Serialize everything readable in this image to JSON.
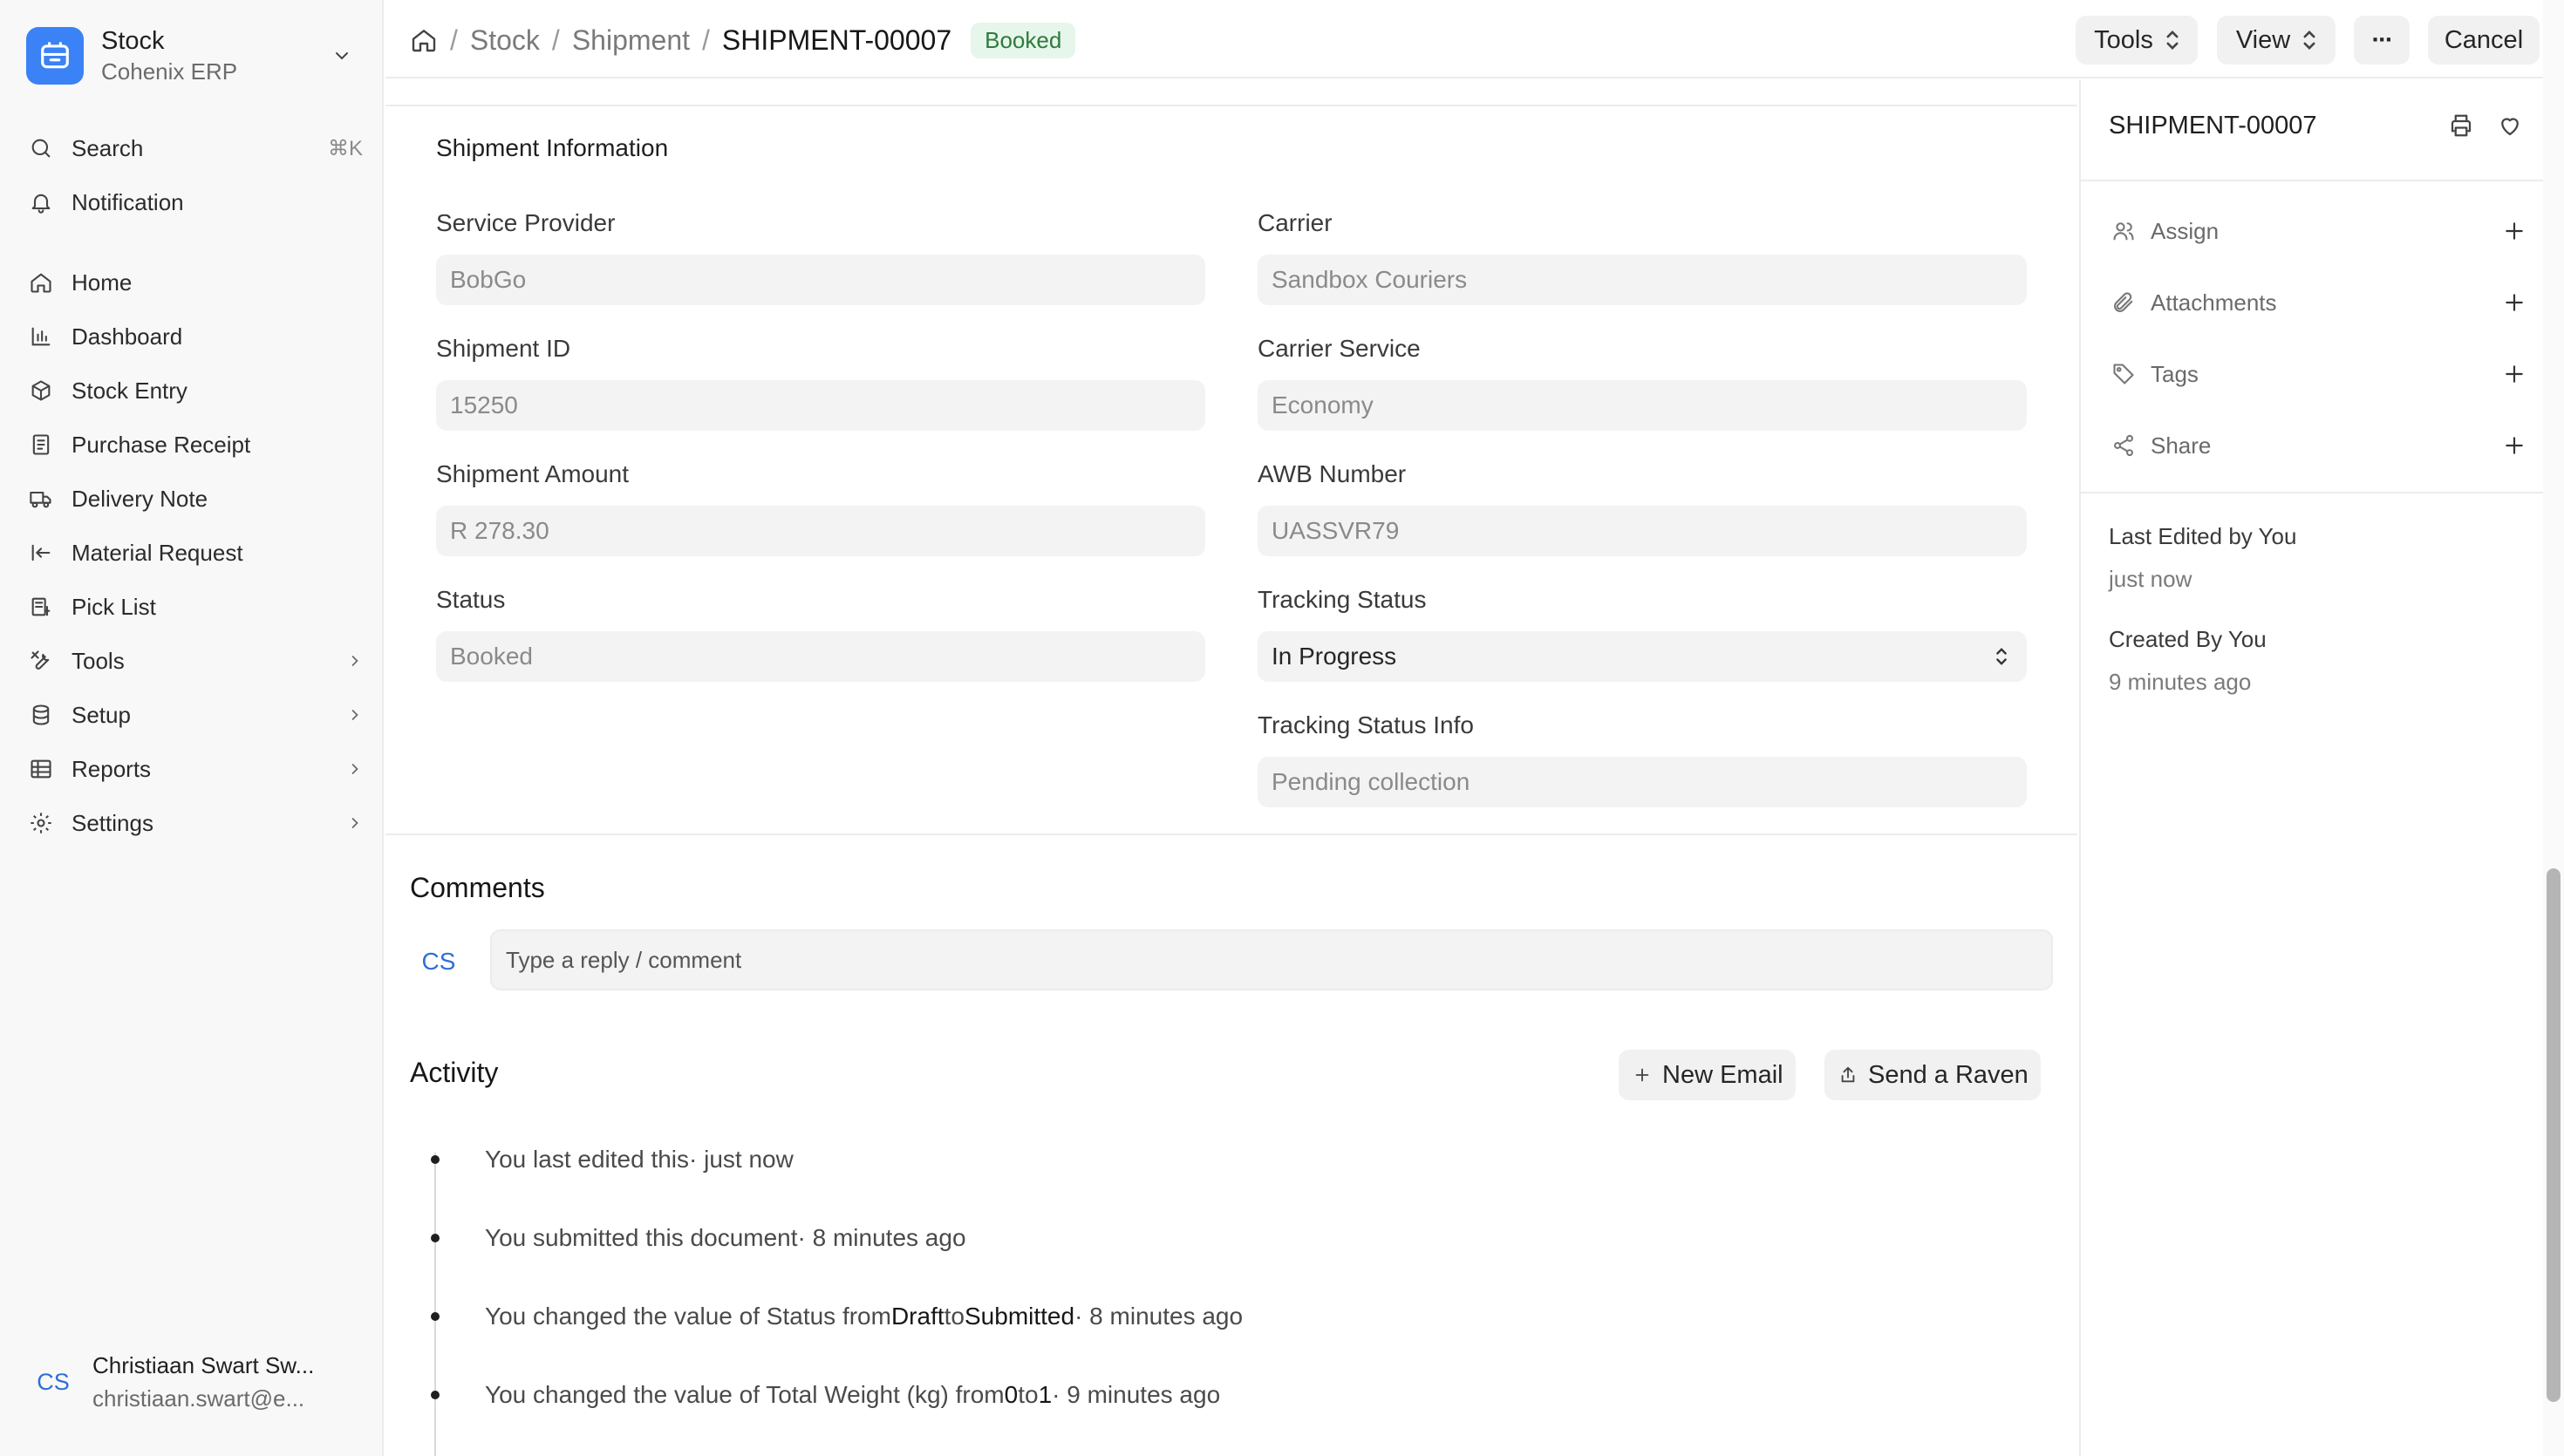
{
  "workspace": {
    "name": "Stock",
    "org": "Cohenix ERP",
    "accent": "#3b82f6"
  },
  "sidebar": {
    "search_label": "Search",
    "search_shortcut": "⌘K",
    "notification_label": "Notification",
    "items": [
      {
        "label": "Home",
        "icon": "home-icon"
      },
      {
        "label": "Dashboard",
        "icon": "bar-chart-icon"
      },
      {
        "label": "Stock Entry",
        "icon": "package-icon"
      },
      {
        "label": "Purchase Receipt",
        "icon": "receipt-icon"
      },
      {
        "label": "Delivery Note",
        "icon": "truck-icon"
      },
      {
        "label": "Material Request",
        "icon": "arrow-left-to-line-icon"
      },
      {
        "label": "Pick List",
        "icon": "pick-list-icon"
      },
      {
        "label": "Tools",
        "icon": "tools-icon"
      },
      {
        "label": "Setup",
        "icon": "database-icon"
      },
      {
        "label": "Reports",
        "icon": "table-icon"
      },
      {
        "label": "Settings",
        "icon": "gear-icon"
      }
    ],
    "user": {
      "initials": "CS",
      "name": "Christiaan Swart Sw...",
      "email": "christiaan.swart@e..."
    }
  },
  "header": {
    "breadcrumbs": [
      "Stock",
      "Shipment",
      "SHIPMENT-00007"
    ],
    "status_badge": "Booked",
    "tools_label": "Tools",
    "view_label": "View",
    "more_label": "···",
    "cancel_label": "Cancel"
  },
  "form": {
    "section_title": "Shipment Information",
    "left": [
      {
        "label": "Service Provider",
        "value": "BobGo"
      },
      {
        "label": "Shipment ID",
        "value": "15250"
      },
      {
        "label": "Shipment Amount",
        "value": "R 278.30"
      },
      {
        "label": "Status",
        "value": "Booked"
      }
    ],
    "right": [
      {
        "label": "Carrier",
        "value": "Sandbox Couriers"
      },
      {
        "label": "Carrier Service",
        "value": "Economy"
      },
      {
        "label": "AWB Number",
        "value": "UASSVR79"
      },
      {
        "label": "Tracking Status",
        "value": "In Progress"
      },
      {
        "label": "Tracking Status Info",
        "value": "Pending collection"
      }
    ]
  },
  "comments": {
    "title": "Comments",
    "avatar": "CS",
    "placeholder": "Type a reply / comment"
  },
  "activity": {
    "title": "Activity",
    "new_email_label": "New Email",
    "send_raven_label": "Send a Raven",
    "items": [
      {
        "pre": "You last edited this",
        "from": "",
        "mid": "",
        "to": "",
        "time": " · just now"
      },
      {
        "pre": "You submitted this document",
        "from": "",
        "mid": "",
        "to": "",
        "time": " · 8 minutes ago"
      },
      {
        "pre": "You changed the value of Status from ",
        "from": "Draft",
        "mid": " to ",
        "to": "Submitted",
        "time": " · 8 minutes ago"
      },
      {
        "pre": "You changed the value of Total Weight (kg) from ",
        "from": "0",
        "mid": " to ",
        "to": "1",
        "time": " · 9 minutes ago"
      }
    ]
  },
  "side_panel": {
    "title": "SHIPMENT-00007",
    "assign_label": "Assign",
    "attachments_label": "Attachments",
    "tags_label": "Tags",
    "share_label": "Share",
    "last_edited_label": "Last Edited by You",
    "last_edited_time": "just now",
    "created_label": "Created By You",
    "created_time": "9 minutes ago"
  }
}
